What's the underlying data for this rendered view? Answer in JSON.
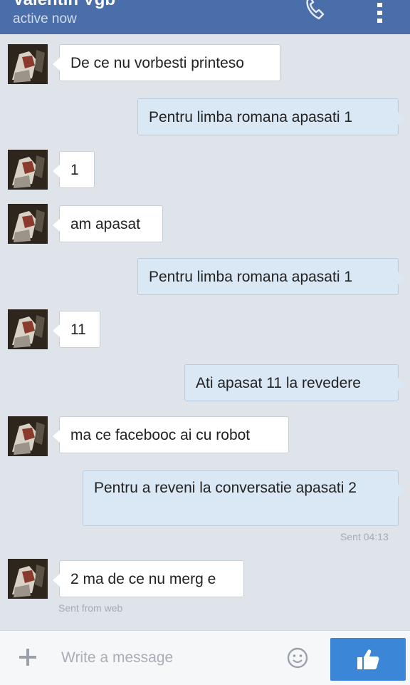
{
  "header": {
    "contact_name": "Valentin Vgb",
    "status": "active now",
    "background": "#4a6ea9",
    "icons": [
      "phone-icon",
      "more-vertical-icon"
    ]
  },
  "messages": [
    {
      "from": "them",
      "text": "De ce nu vorbesti printeso"
    },
    {
      "from": "me",
      "text": "Pentru limba romana apasati 1"
    },
    {
      "from": "them",
      "text": "1"
    },
    {
      "from": "them",
      "text": "am apasat"
    },
    {
      "from": "me",
      "text": "Pentru limba romana apasati 1"
    },
    {
      "from": "them",
      "text": "11"
    },
    {
      "from": "me",
      "text": "Ati apasat 11 la revedere"
    },
    {
      "from": "them",
      "text": "ma ce facebooc ai cu robot"
    },
    {
      "from": "me",
      "text": "Pentru a reveni la conversatie apasati 2",
      "meta": "Sent 04:13"
    },
    {
      "from": "them",
      "text": "2 ma de ce nu merg e",
      "meta": "Sent from web"
    }
  ],
  "composer": {
    "placeholder": "Write a message",
    "icons": [
      "plus-icon",
      "emoji-icon",
      "thumbs-up-icon"
    ],
    "like_color": "#3b86d6"
  }
}
